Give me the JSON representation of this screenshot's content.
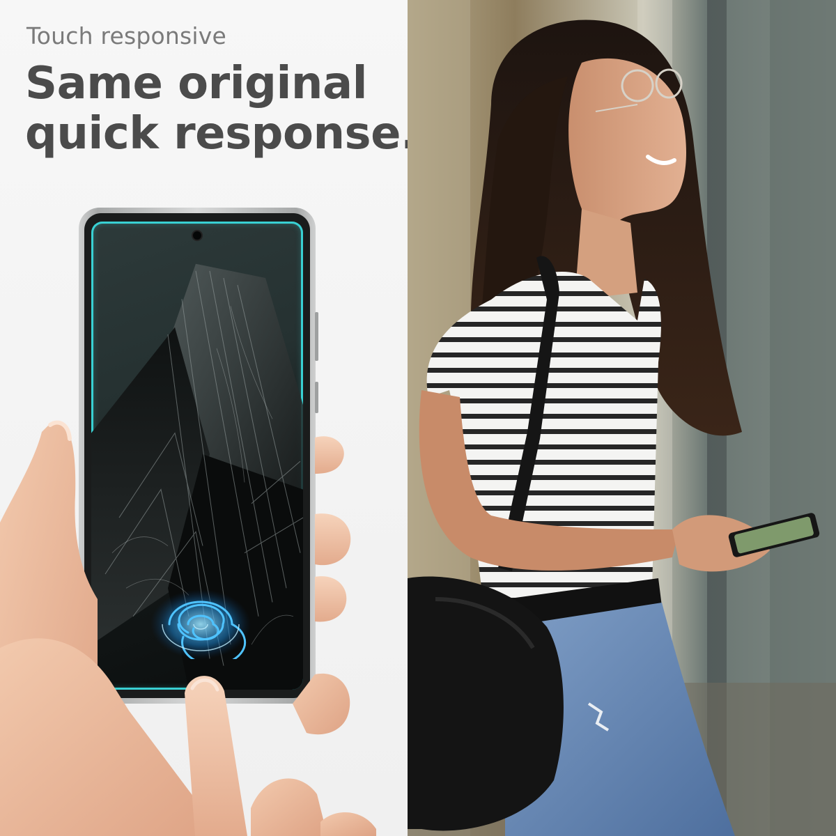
{
  "header": {
    "eyebrow": "Touch responsive",
    "headline_line1": "Same original",
    "headline_line2": "quick response."
  },
  "colors": {
    "accent": "#39d0d3",
    "headline": "#4b4b4b",
    "eyebrow": "#7a7a7a"
  },
  "icons": {
    "touch": "touch-ripple-icon"
  }
}
